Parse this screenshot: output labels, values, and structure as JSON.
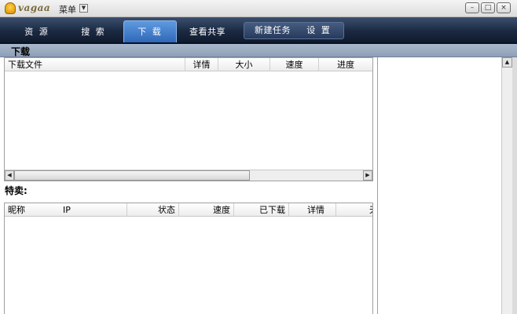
{
  "app": {
    "logo_text": "vagaa",
    "menu_label": "菜单"
  },
  "window_controls": {
    "minimize": "–",
    "restore": "□",
    "close": "×"
  },
  "nav": {
    "tabs": [
      {
        "label": "资 源"
      },
      {
        "label": "搜 索"
      },
      {
        "label": "下 载",
        "active": true
      },
      {
        "label": "查看共享"
      }
    ],
    "group_tabs": [
      {
        "label": "新建任务"
      },
      {
        "label": "设 置"
      }
    ]
  },
  "section": {
    "title": "下载"
  },
  "download_list": {
    "columns": [
      "下载文件",
      "详情",
      "大小",
      "速度",
      "进度"
    ]
  },
  "special": {
    "label": "特卖:"
  },
  "peer_list": {
    "columns": [
      "昵称",
      "IP",
      "状态",
      "速度",
      "已下载",
      "详情",
      "天"
    ]
  },
  "colors": {
    "nav_bg": "#1b2a42",
    "active_tab": "#2f67b8",
    "section_bg": "#a9b8cc"
  }
}
